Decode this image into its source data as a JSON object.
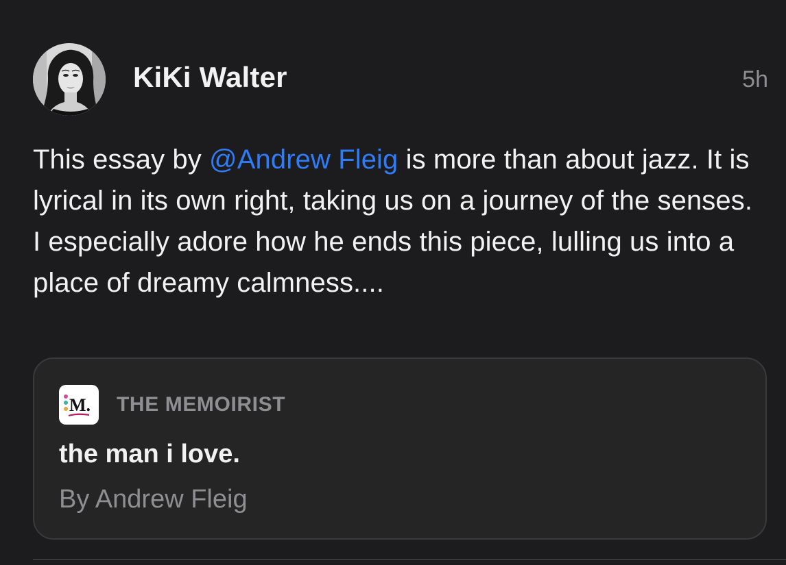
{
  "post": {
    "author_name": "KiKi Walter",
    "timestamp": "5h",
    "text_before_mention": "This essay by ",
    "mention": "@Andrew Fleig",
    "text_after_mention": " is more than about jazz. It is lyrical in its own right, taking us on a journey of the senses. I especially adore how he ends this piece, lulling us into a place of dreamy calmness...."
  },
  "link_card": {
    "publication_logo_icon": "memoirist-logo-icon",
    "publication_logo_text": "M.",
    "publication_name": "THE MEMOIRIST",
    "title": "the man i love.",
    "byline": "By Andrew Fleig"
  },
  "colors": {
    "background": "#1c1c1e",
    "card_background": "#252525",
    "mention": "#2f7cf6",
    "secondary_text": "#8e8e93"
  }
}
